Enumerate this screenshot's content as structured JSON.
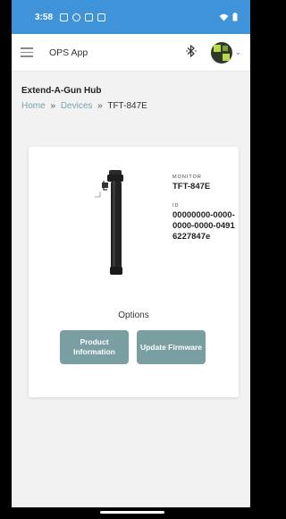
{
  "status_bar": {
    "time": "3:58",
    "icons": [
      "notification-icon",
      "app-icon",
      "sim-icon",
      "card-icon"
    ],
    "right_icons": [
      "wifi-icon",
      "battery-icon"
    ]
  },
  "app_bar": {
    "title": "OPS App",
    "menu_icon": "hamburger-menu-icon",
    "bluetooth_icon": "bluetooth-icon",
    "avatar_icon": "avatar"
  },
  "page": {
    "title": "Extend-A-Gun Hub",
    "breadcrumb": {
      "home": "Home",
      "devices": "Devices",
      "current": "TFT-847E",
      "separator": "»"
    }
  },
  "device_card": {
    "monitor_label": "MONITOR",
    "monitor_value": "TFT-847E",
    "id_label": "ID",
    "id_value": "00000000-0000-0000-0000-04916227847e",
    "options_label": "Options",
    "buttons": {
      "product_information": "Product Information",
      "update_firmware": "Update Firmware"
    }
  },
  "colors": {
    "status_bar": "#3f93d8",
    "button": "#7a9fa3",
    "link": "#7aa3b3"
  }
}
